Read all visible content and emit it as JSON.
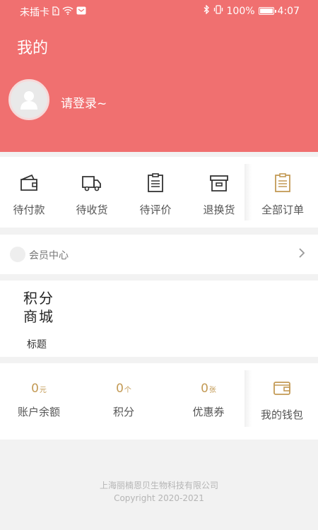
{
  "status_bar": {
    "carrier": "未插卡",
    "battery": "100%",
    "time": "4:07"
  },
  "header": {
    "title": "我的",
    "login_text": "请登录~"
  },
  "orders": {
    "items": [
      {
        "label": "待付款",
        "icon": "wallet-icon"
      },
      {
        "label": "待收货",
        "icon": "truck-icon"
      },
      {
        "label": "待评价",
        "icon": "clipboard-icon"
      },
      {
        "label": "退换货",
        "icon": "box-icon"
      },
      {
        "label": "全部订单",
        "icon": "order-list-icon"
      }
    ]
  },
  "member": {
    "label": "会员中心"
  },
  "points_mall": {
    "logo_text": "积分商城",
    "logo_line1": "积分",
    "logo_line2": "商城",
    "title": "标题"
  },
  "wallet": {
    "items": [
      {
        "value": "0",
        "unit": "元",
        "label": "账户余额"
      },
      {
        "value": "0",
        "unit": "个",
        "label": "积分"
      },
      {
        "value": "0",
        "unit": "张",
        "label": "优惠券"
      }
    ],
    "my_wallet": "我的钱包"
  },
  "footer": {
    "company": "上海丽楠恩贝生物科技有限公司",
    "copyright": "Copyright 2020-2021"
  },
  "colors": {
    "header_bg": "#f07070",
    "accent_gold": "#c39a55"
  }
}
